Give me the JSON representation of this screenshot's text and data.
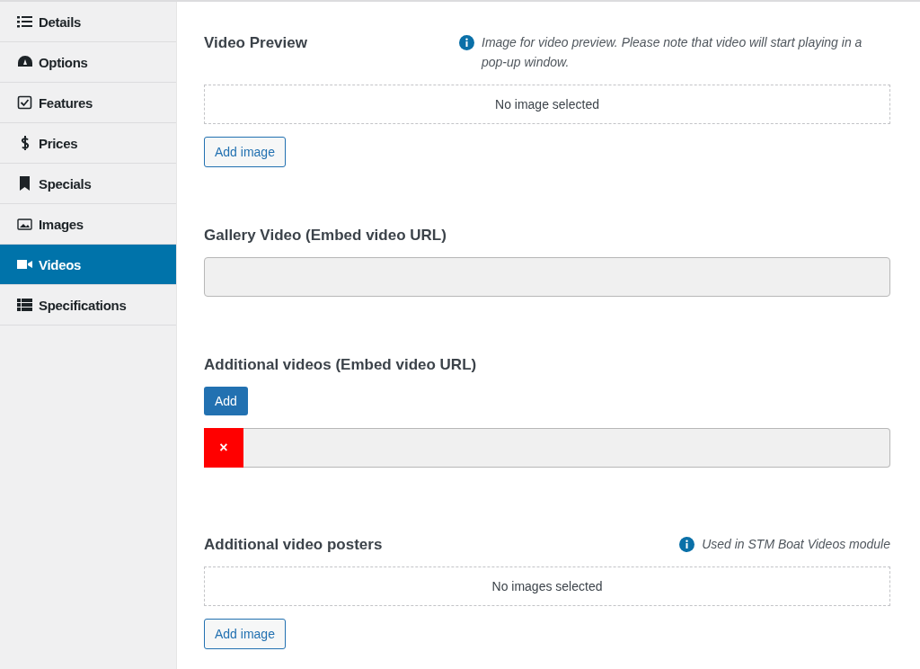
{
  "sidebar": {
    "items": [
      {
        "label": "Details",
        "selected": false
      },
      {
        "label": "Options",
        "selected": false
      },
      {
        "label": "Features",
        "selected": false
      },
      {
        "label": "Prices",
        "selected": false
      },
      {
        "label": "Specials",
        "selected": false
      },
      {
        "label": "Images",
        "selected": false
      },
      {
        "label": "Videos",
        "selected": true
      },
      {
        "label": "Specifications",
        "selected": false
      }
    ]
  },
  "sections": [
    {
      "kind": "image_picker",
      "title": "Video Preview",
      "hint": "Image for video preview. Please note that video will start playing in a pop-up window.",
      "empty_text": "No image selected",
      "button": "Add image"
    },
    {
      "kind": "url_field",
      "title": "Gallery Video (Embed video URL)"
    },
    {
      "kind": "repeater",
      "title": "Additional videos (Embed video URL)",
      "button": "Add",
      "remove": "×"
    },
    {
      "kind": "image_picker",
      "title": "Additional video posters",
      "hint": "Used in STM Boat Videos module",
      "empty_text": "No images selected",
      "button": "Add image"
    }
  ]
}
